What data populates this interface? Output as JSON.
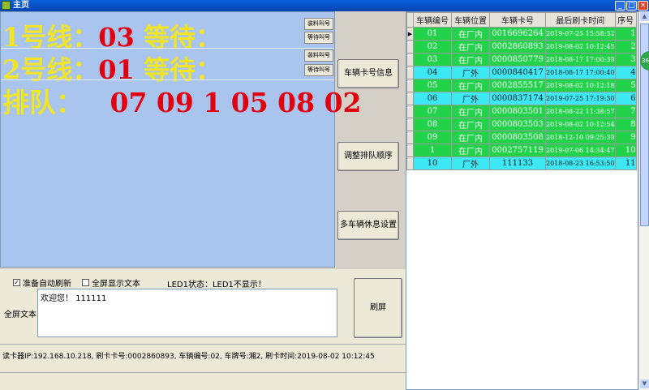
{
  "window": {
    "title": "主页"
  },
  "queue_display": {
    "line1": {
      "label": "1号线：",
      "number": "03",
      "wait_label": "等待："
    },
    "line2": {
      "label": "2号线：",
      "number": "01",
      "wait_label": "等待："
    },
    "queue": {
      "label": "排队：",
      "values": "07 09 1 05 08 02"
    }
  },
  "small_buttons": {
    "line1_load": "装料叫号",
    "line1_wait": "等待叫号",
    "line2_load": "装料叫号",
    "line2_wait": "等待叫号"
  },
  "actions": {
    "vehicle_card_info": "车辆卡号信息",
    "adjust_queue_order": "调整排队顺序",
    "multi_vehicle_rest": "多车辆休息设置",
    "refresh_screen": "刷屏"
  },
  "grid": {
    "columns": [
      "车辆编号",
      "车辆位置",
      "车辆卡号",
      "最后刷卡时间",
      "序号"
    ],
    "rows": [
      {
        "vehicle_no": "01",
        "location": "在厂内",
        "card_no": "0016696264",
        "last_swipe": "2019-07-25 15:58:32",
        "seq": "1",
        "color": "green"
      },
      {
        "vehicle_no": "02",
        "location": "在厂内",
        "card_no": "0002860893",
        "last_swipe": "2019-08-02 10:12:45",
        "seq": "2",
        "color": "green"
      },
      {
        "vehicle_no": "03",
        "location": "在厂内",
        "card_no": "0000850779",
        "last_swipe": "2018-08-17 17:00:39",
        "seq": "3",
        "color": "green"
      },
      {
        "vehicle_no": "04",
        "location": "厂外",
        "card_no": "0000840417",
        "last_swipe": "2018-08-17 17:00:40",
        "seq": "4",
        "color": "cyan"
      },
      {
        "vehicle_no": "05",
        "location": "在厂内",
        "card_no": "0002855517",
        "last_swipe": "2019-08-02 10:12:18",
        "seq": "5",
        "color": "green"
      },
      {
        "vehicle_no": "06",
        "location": "厂外",
        "card_no": "0000837174",
        "last_swipe": "2019-07-25 17:19:30",
        "seq": "6",
        "color": "cyan"
      },
      {
        "vehicle_no": "07",
        "location": "在厂内",
        "card_no": "0000803501",
        "last_swipe": "2018-08-22 11:38:57",
        "seq": "7",
        "color": "green"
      },
      {
        "vehicle_no": "08",
        "location": "在厂内",
        "card_no": "0000803503",
        "last_swipe": "2019-08-02 10:12:54",
        "seq": "8",
        "color": "green"
      },
      {
        "vehicle_no": "09",
        "location": "在厂内",
        "card_no": "0000803508",
        "last_swipe": "2018-12-10 09:25:39",
        "seq": "9",
        "color": "green"
      },
      {
        "vehicle_no": "1",
        "location": "在厂内",
        "card_no": "0002757119",
        "last_swipe": "2019-07-06 14:34:47",
        "seq": "10",
        "color": "green"
      },
      {
        "vehicle_no": "10",
        "location": "厂外",
        "card_no": "111133",
        "last_swipe": "2018-08-23 16:53:50",
        "seq": "11",
        "color": "cyan"
      }
    ]
  },
  "options": {
    "auto_refresh": {
      "label": "准备自动刷新",
      "checked": true
    },
    "fullscreen_text": {
      "label": "全屏显示文本",
      "checked": false
    }
  },
  "led_status": "LED1状态：LED1不显示！",
  "fullscreen": {
    "label": "全屏文本",
    "value": "欢迎您！ 111111"
  },
  "status_bar": "读卡器IP:192.168.10.218,   刷卡卡号:0002860893,   车辆编号:02,   车牌号:湘2,   刷卡时间:2019-08-02 10:12:45",
  "side_badge": "36",
  "colors": {
    "green_row": "#22d24b",
    "cyan_row": "#3ce8f4",
    "panel_bg": "#a9c5ee",
    "yellow_text": "#f0e428",
    "red_text": "#e00010"
  }
}
